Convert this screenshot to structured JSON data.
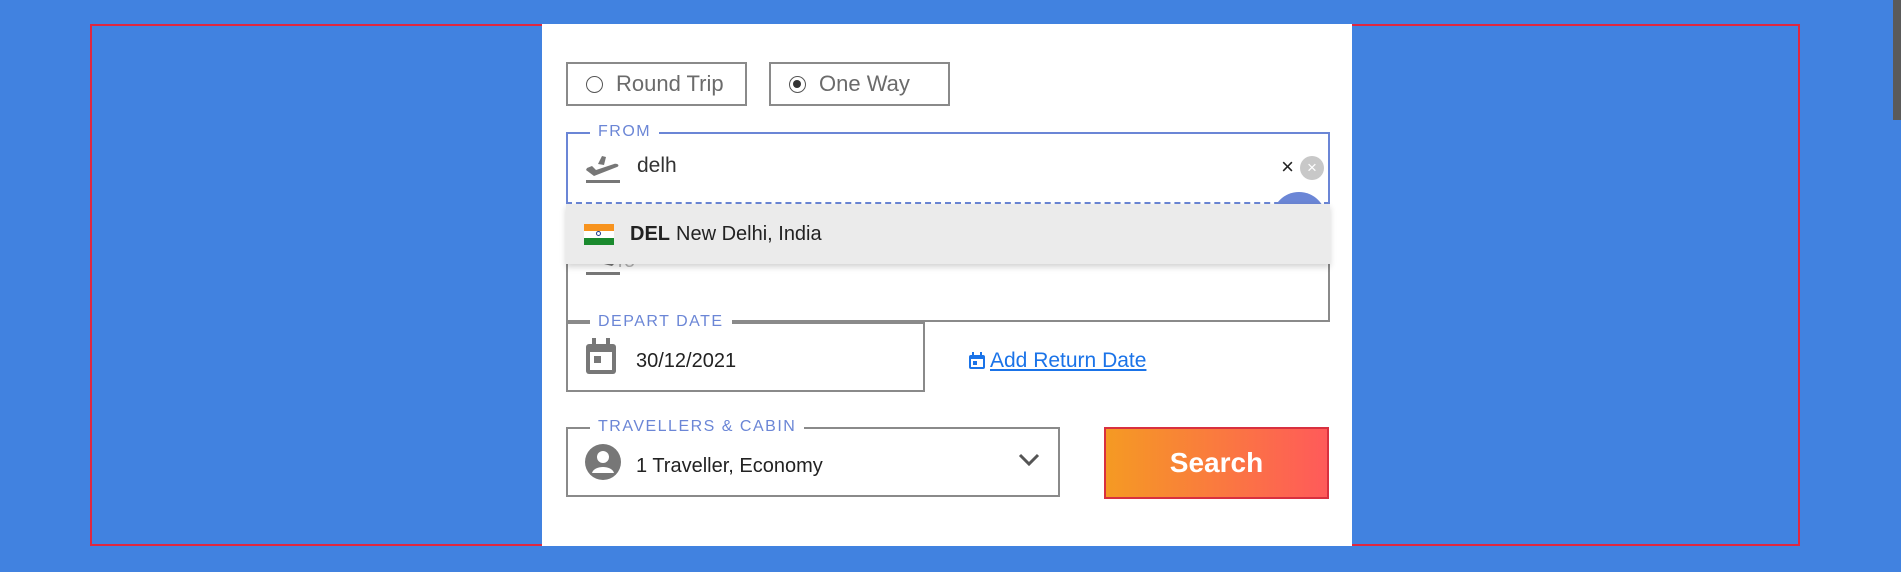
{
  "trip_type": {
    "options": [
      {
        "label": "Round Trip",
        "selected": false
      },
      {
        "label": "One Way",
        "selected": true
      }
    ]
  },
  "from": {
    "label": "FROM",
    "value": "delh",
    "clear_label": "×",
    "clear_circle_label": "×",
    "icon": "takeoff-icon"
  },
  "to": {
    "placeholder": "To",
    "icon": "landing-icon"
  },
  "suggestions": [
    {
      "code": "DEL",
      "city": "New Delhi, India",
      "flag": "india-flag-icon"
    }
  ],
  "depart": {
    "label": "DEPART DATE",
    "value": "30/12/2021",
    "icon": "calendar-icon"
  },
  "return": {
    "label": "Add Return Date",
    "icon": "calendar-small-icon"
  },
  "travellers": {
    "label": "TRAVELLERS & CABIN",
    "value": "1 Traveller, Economy",
    "icon": "person-icon"
  },
  "search": {
    "label": "Search"
  },
  "colors": {
    "page_bg": "#4182e0",
    "accent_blue": "#6b86d6",
    "link": "#1a73e8",
    "search_gradient_start": "#f59a23",
    "search_gradient_end": "#ff5a5a",
    "frame_red": "#e0273f"
  }
}
